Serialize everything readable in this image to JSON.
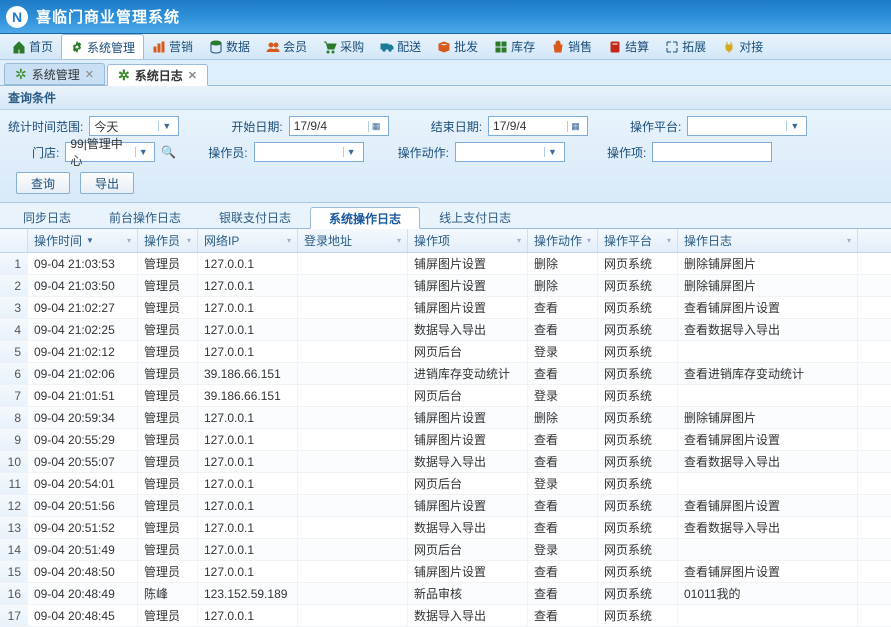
{
  "app": {
    "title": "喜临门商业管理系统",
    "logo_letter": "N"
  },
  "menu": [
    {
      "icon": "home",
      "color": "#2a7a2a",
      "label": "首页"
    },
    {
      "icon": "gear",
      "color": "#2a7a2a",
      "label": "系统管理",
      "active": true
    },
    {
      "icon": "chart",
      "color": "#d85a1a",
      "label": "营销"
    },
    {
      "icon": "db",
      "color": "#2a7a2a",
      "label": "数据"
    },
    {
      "icon": "users",
      "color": "#d85a1a",
      "label": "会员"
    },
    {
      "icon": "cart",
      "color": "#2a7a2a",
      "label": "采购"
    },
    {
      "icon": "truck",
      "color": "#1a7a9a",
      "label": "配送"
    },
    {
      "icon": "box",
      "color": "#d85a1a",
      "label": "批发"
    },
    {
      "icon": "stock",
      "color": "#2a7a2a",
      "label": "库存"
    },
    {
      "icon": "bag",
      "color": "#d85a1a",
      "label": "销售"
    },
    {
      "icon": "calc",
      "color": "#c4281a",
      "label": "结算"
    },
    {
      "icon": "expand",
      "color": "#1a7a9a",
      "label": "拓展"
    },
    {
      "icon": "plug",
      "color": "#d4aa1a",
      "label": "对接"
    }
  ],
  "open_tabs": [
    {
      "label": "系统管理",
      "active": false
    },
    {
      "label": "系统日志",
      "active": true
    }
  ],
  "query": {
    "section_title": "查询条件",
    "time_range_label": "统计时间范围:",
    "time_range_value": "今天",
    "start_date_label": "开始日期:",
    "start_date_value": "17/9/4",
    "end_date_label": "结束日期:",
    "end_date_value": "17/9/4",
    "platform_label": "操作平台:",
    "platform_value": "",
    "store_label": "门店:",
    "store_value": "99|管理中心",
    "operator_label": "操作员:",
    "operator_value": "",
    "action_label": "操作动作:",
    "action_value": "",
    "item_label": "操作项:",
    "item_value": ""
  },
  "buttons": {
    "search": "查询",
    "export": "导出"
  },
  "inner_tabs": [
    {
      "label": "同步日志"
    },
    {
      "label": "前台操作日志"
    },
    {
      "label": "银联支付日志"
    },
    {
      "label": "系统操作日志",
      "active": true
    },
    {
      "label": "线上支付日志"
    }
  ],
  "grid": {
    "columns": [
      "操作时间",
      "操作员",
      "网络IP",
      "登录地址",
      "操作项",
      "操作动作",
      "操作平台",
      "操作日志"
    ],
    "sort_desc_on": 0,
    "rows": [
      {
        "n": 1,
        "time": "09-04 21:03:53",
        "op": "管理员",
        "ip": "127.0.0.1",
        "addr": "",
        "item": "铺屏图片设置",
        "action": "删除",
        "plat": "网页系统",
        "log": "删除铺屏图片"
      },
      {
        "n": 2,
        "time": "09-04 21:03:50",
        "op": "管理员",
        "ip": "127.0.0.1",
        "addr": "",
        "item": "铺屏图片设置",
        "action": "删除",
        "plat": "网页系统",
        "log": "删除铺屏图片"
      },
      {
        "n": 3,
        "time": "09-04 21:02:27",
        "op": "管理员",
        "ip": "127.0.0.1",
        "addr": "",
        "item": "铺屏图片设置",
        "action": "查看",
        "plat": "网页系统",
        "log": "查看铺屏图片设置"
      },
      {
        "n": 4,
        "time": "09-04 21:02:25",
        "op": "管理员",
        "ip": "127.0.0.1",
        "addr": "",
        "item": "数据导入导出",
        "action": "查看",
        "plat": "网页系统",
        "log": "查看数据导入导出"
      },
      {
        "n": 5,
        "time": "09-04 21:02:12",
        "op": "管理员",
        "ip": "127.0.0.1",
        "addr": "",
        "item": "网页后台",
        "action": "登录",
        "plat": "网页系统",
        "log": ""
      },
      {
        "n": 6,
        "time": "09-04 21:02:06",
        "op": "管理员",
        "ip": "39.186.66.151",
        "addr": "",
        "item": "进销库存变动统计",
        "action": "查看",
        "plat": "网页系统",
        "log": "查看进销库存变动统计"
      },
      {
        "n": 7,
        "time": "09-04 21:01:51",
        "op": "管理员",
        "ip": "39.186.66.151",
        "addr": "",
        "item": "网页后台",
        "action": "登录",
        "plat": "网页系统",
        "log": ""
      },
      {
        "n": 8,
        "time": "09-04 20:59:34",
        "op": "管理员",
        "ip": "127.0.0.1",
        "addr": "",
        "item": "铺屏图片设置",
        "action": "删除",
        "plat": "网页系统",
        "log": "删除铺屏图片"
      },
      {
        "n": 9,
        "time": "09-04 20:55:29",
        "op": "管理员",
        "ip": "127.0.0.1",
        "addr": "",
        "item": "铺屏图片设置",
        "action": "查看",
        "plat": "网页系统",
        "log": "查看铺屏图片设置"
      },
      {
        "n": 10,
        "time": "09-04 20:55:07",
        "op": "管理员",
        "ip": "127.0.0.1",
        "addr": "",
        "item": "数据导入导出",
        "action": "查看",
        "plat": "网页系统",
        "log": "查看数据导入导出"
      },
      {
        "n": 11,
        "time": "09-04 20:54:01",
        "op": "管理员",
        "ip": "127.0.0.1",
        "addr": "",
        "item": "网页后台",
        "action": "登录",
        "plat": "网页系统",
        "log": ""
      },
      {
        "n": 12,
        "time": "09-04 20:51:56",
        "op": "管理员",
        "ip": "127.0.0.1",
        "addr": "",
        "item": "铺屏图片设置",
        "action": "查看",
        "plat": "网页系统",
        "log": "查看铺屏图片设置"
      },
      {
        "n": 13,
        "time": "09-04 20:51:52",
        "op": "管理员",
        "ip": "127.0.0.1",
        "addr": "",
        "item": "数据导入导出",
        "action": "查看",
        "plat": "网页系统",
        "log": "查看数据导入导出"
      },
      {
        "n": 14,
        "time": "09-04 20:51:49",
        "op": "管理员",
        "ip": "127.0.0.1",
        "addr": "",
        "item": "网页后台",
        "action": "登录",
        "plat": "网页系统",
        "log": ""
      },
      {
        "n": 15,
        "time": "09-04 20:48:50",
        "op": "管理员",
        "ip": "127.0.0.1",
        "addr": "",
        "item": "铺屏图片设置",
        "action": "查看",
        "plat": "网页系统",
        "log": "查看铺屏图片设置"
      },
      {
        "n": 16,
        "time": "09-04 20:48:49",
        "op": "陈峰",
        "ip": "123.152.59.189",
        "addr": "",
        "item": "新品审核",
        "action": "查看",
        "plat": "网页系统",
        "log": "01011我的"
      },
      {
        "n": 17,
        "time": "09-04 20:48:45",
        "op": "管理员",
        "ip": "127.0.0.1",
        "addr": "",
        "item": "数据导入导出",
        "action": "查看",
        "plat": "网页系统",
        "log": ""
      }
    ]
  }
}
